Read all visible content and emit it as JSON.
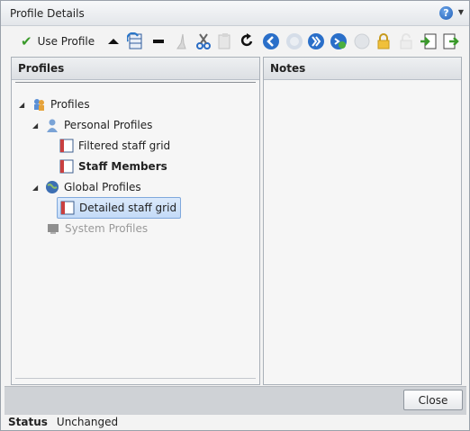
{
  "window": {
    "title": "Profile Details"
  },
  "toolbar": {
    "use_profile_label": "Use Profile",
    "icons": [
      "move-up-icon",
      "refresh-grid-icon",
      "remove-icon",
      "broom-icon",
      "cut-icon",
      "paste-icon",
      "redo-icon",
      "back-nav-icon",
      "stop-icon",
      "forward-nav-icon",
      "add-profile-icon",
      "globe-icon",
      "lock-icon",
      "unlock-icon",
      "import-icon",
      "export-icon"
    ]
  },
  "profiles_panel": {
    "header": "Profiles",
    "tree": {
      "root": "Profiles",
      "personal": "Personal Profiles",
      "filtered": "Filtered staff grid",
      "staff": "Staff Members",
      "global": "Global Profiles",
      "detailed": "Detailed staff grid",
      "system": "System Profiles"
    }
  },
  "notes_panel": {
    "header": "Notes"
  },
  "footer": {
    "close_label": "Close"
  },
  "status": {
    "label": "Status",
    "value": "Unchanged"
  },
  "colors": {
    "selection": "#c4dbf7",
    "accent": "#1f5fb9"
  }
}
